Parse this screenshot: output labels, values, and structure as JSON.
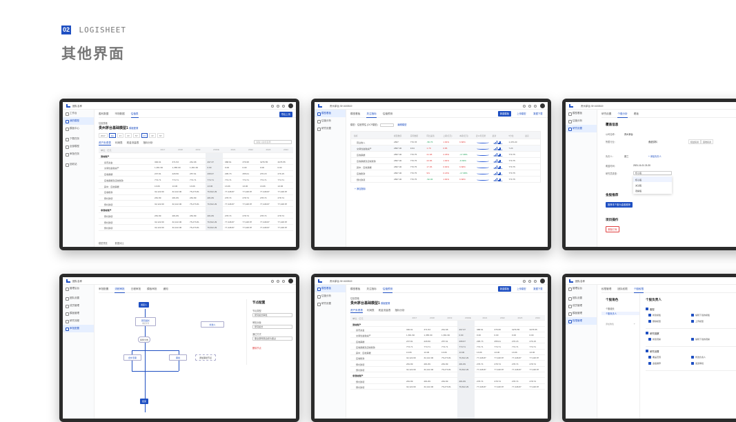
{
  "header": {
    "badge": "02",
    "brand": "LOGISHEET",
    "title": "其他界面"
  },
  "shot1": {
    "topbar": {
      "company": "团队名称"
    },
    "sidebar": [
      "工作台",
      "我的模型",
      "模板中心",
      "下载任务",
      "全部模型",
      "审批任务",
      "回收站"
    ],
    "tabs": [
      "盈利数据",
      "市场数据",
      "估值表"
    ],
    "action_button": "导出上传",
    "crumb": "估值表格",
    "title": "贵州茅台基础模型1",
    "title_link": "模板配置",
    "subtabs": [
      "资产负债表",
      "利润表",
      "现金流量表",
      "指标分析"
    ],
    "search_placeholder": "请输入指标名称",
    "col_headers": [
      "单位：亿元",
      "2017",
      "2018",
      "2019",
      "2020E",
      "2021",
      "2022",
      "2023",
      "2024"
    ],
    "rows": [
      {
        "label": "流动资产",
        "vals": []
      },
      {
        "label": "货币资金",
        "vals": [
          "300.01",
          "371.53",
          "261.68",
          "297.37",
          "388.61",
          "376.95",
          "3276.55",
          "3276.55"
        ]
      },
      {
        "label": "交易性金融资产",
        "vals": [
          "1,361.60",
          "1,365.00",
          "1,361.60",
          "0.00",
          "0.00",
          "0.00",
          "0.00",
          "0.00"
        ]
      },
      {
        "label": "应收票据",
        "vals": [
          "237.81",
          "226.56",
          "257.61",
          "295.67",
          "295.73",
          "255.01",
          "276.15",
          "276.15"
        ]
      },
      {
        "label": "应收票据及应收账款",
        "vals": [
          "774.71",
          "774.71",
          "774.71",
          "774.71",
          "774.71",
          "774.71",
          "774.71",
          "774.71"
        ]
      },
      {
        "label": "其中：应收票据",
        "vals": [
          "13.06",
          "13.06",
          "13.06",
          "13.06",
          "13.06",
          "13.06",
          "13.06",
          "13.06"
        ]
      },
      {
        "label": "应收账款",
        "vals": [
          "32,122.00",
          "32,122.00",
          "75,273.81",
          "76,812.29",
          "77,448.87",
          "77,448.87",
          "77,448.87",
          "77,448.87"
        ]
      },
      {
        "label": "预付款项",
        "vals": [
          "281.89",
          "281.89",
          "281.89",
          "281.89",
          "278.74",
          "278.74",
          "278.74",
          "278.74"
        ]
      },
      {
        "label": "预付款项",
        "vals": [
          "32,122.00",
          "32,122.00",
          "75,273.81",
          "76,812.29",
          "77,448.87",
          "77,448.87",
          "77,448.87",
          "77,448.87"
        ]
      },
      {
        "label": "非流动资产",
        "vals": []
      },
      {
        "label": "预付款项",
        "vals": [
          "281.89",
          "281.89",
          "281.89",
          "281.89",
          "278.74",
          "278.74",
          "278.74",
          "278.74"
        ]
      },
      {
        "label": "预付款项",
        "vals": [
          "32,122.00",
          "32,122.00",
          "75,273.81",
          "76,812.29",
          "77,448.87",
          "77,448.87",
          "77,448.87",
          "77,448.87"
        ]
      },
      {
        "label": "预付款项",
        "vals": [
          "32,122.00",
          "32,122.00",
          "75,273.81",
          "76,812.29",
          "77,448.87",
          "77,448.87",
          "77,448.87",
          "77,448.87"
        ]
      }
    ],
    "footer": [
      "模型预览",
      "数据对比"
    ]
  },
  "shot2": {
    "topbar": {
      "company": "贵州茅台 SH.600519"
    },
    "sidebar": [
      "模型看板",
      "估值分析",
      "研究设置"
    ],
    "tabs": [
      "模型看板",
      "关注指标",
      "估值预测"
    ],
    "buttons": [
      "新建模板",
      "上传模型",
      "数据下载"
    ],
    "filter_label": "模型：",
    "filter_value": "估值预估 (DCF模型)",
    "filter_link": "编辑模型",
    "col_headers": [
      "指标",
      "模型数值",
      "实际数据",
      "同比差值",
      "上期(亿元)",
      "本期(亿元)",
      "近12月走势",
      "最新",
      "5分位",
      "最高"
    ],
    "rows": [
      {
        "label": "营业收入",
        "vals": [
          "2807",
          "770.78",
          "-56.76",
          "1.84%",
          "6.68%",
          "1,470.20"
        ]
      },
      {
        "label": "交易性金融资产",
        "vals": [
          "2807.00",
          "9.64",
          "1.79",
          "0.85",
          "",
          "7.23"
        ]
      },
      {
        "label": "应收票据",
        "vals": [
          "2807.00",
          "770.75",
          "21.98",
          "2.45%",
          "-17.38%",
          "770.75"
        ]
      },
      {
        "label": "应收票据及应收账款",
        "vals": [
          "2807.00",
          "770.75",
          "23.86",
          "1.84%",
          "-8.30%",
          "770.75"
        ]
      },
      {
        "label": "其中：应收票据",
        "vals": [
          "2807.00",
          "770.75",
          "17.06",
          "0.84%",
          "6.68%",
          "770.75"
        ]
      },
      {
        "label": "应收账款",
        "vals": [
          "2807.00",
          "770.75",
          "9%",
          "0.18%",
          "-17.38%",
          "770.75"
        ]
      },
      {
        "label": "预付款项",
        "vals": [
          "2807.00",
          "770.75",
          "-52.06",
          "1.84%",
          "6.68%",
          "770.75"
        ]
      }
    ],
    "add_link": "+ 添加指标"
  },
  "shot3": {
    "topbar": {
      "company": "贵州茅台 SH.600519"
    },
    "sidebar": [
      "模型看板",
      "估值分析",
      "研究设置"
    ],
    "tabs": [
      "研究设置",
      "个股分析",
      "看板"
    ],
    "section1": "覆盖信息",
    "fields": [
      {
        "label": "公司名称：",
        "value": "贵州茅台"
      },
      {
        "label": "所属行业：",
        "value": "食品饮料"
      },
      {
        "label": "负责人：",
        "value": "张三"
      },
      {
        "label": "覆盖时间：",
        "value": "2021-11-01 21:20"
      },
      {
        "label": "研究员类型：",
        "value": "核心股"
      }
    ],
    "tags": [
      "权益投资",
      "固收投资"
    ],
    "add_manager": "+ 添加负责人",
    "dropdown_options": [
      "核心股",
      "关注股",
      "观察股"
    ],
    "section2": "金股推荐",
    "recommend_button": "推荐本个股为金股推荐",
    "section3": "项目操作",
    "delete_button": "删除已有"
  },
  "shot4": {
    "topbar": {
      "company": "团队名称"
    },
    "sidebar": [
      "管理后台",
      "团队设置",
      "成员管理",
      "模板管理",
      "研究流程",
      "审批配置"
    ],
    "tabs": [
      "审批配置",
      "流程审批",
      "日程审批",
      "模板审批",
      "通知"
    ],
    "nodes": {
      "start": "发起人",
      "n1": "研究组长",
      "n2": "审核条件",
      "n3": "条件分支",
      "n4": "合伙专审",
      "n5": "审批",
      "n6": "添加审批节点",
      "end": "结束",
      "cc": "抄送人"
    },
    "panel_title": "节点配置",
    "panel_fields": [
      {
        "label": "节点类型",
        "value": "研究组长审批"
      },
      {
        "label": "审批对象",
        "value": "研究组长"
      },
      {
        "label": "通过方式",
        "value": "需全部同意后视为通过"
      }
    ],
    "panel_delete": "删除节点"
  },
  "shot5": {
    "topbar": {
      "company": "贵州茅台 SH.600519"
    },
    "sidebar": [
      "模型看板",
      "估值分析",
      "研究设置"
    ],
    "tabs": [
      "模型看板",
      "关注指标",
      "估值预测"
    ],
    "buttons": [
      "新建模板",
      "上传模型",
      "数据下载"
    ],
    "crumb": "估值表格",
    "title": "贵州茅台基础模型1",
    "title_link": "模板配置",
    "subtabs": [
      "资产负债表",
      "利润表",
      "现金流量表",
      "指标分析"
    ],
    "col_headers": [
      "单位：亿元",
      "2017",
      "2018",
      "2019",
      "2020E",
      "2021",
      "2022",
      "2023",
      "2024"
    ],
    "rows": [
      {
        "label": "流动资产",
        "vals": []
      },
      {
        "label": "货币资金",
        "vals": [
          "300.01",
          "371.53",
          "261.68",
          "297.37",
          "388.61",
          "376.95",
          "3276.55",
          "3276.55"
        ]
      },
      {
        "label": "交易性金融资产",
        "vals": [
          "1,361.60",
          "1,365.00",
          "1,361.60",
          "0.00",
          "0.00",
          "0.00",
          "0.00",
          "0.00"
        ]
      },
      {
        "label": "应收票据",
        "vals": [
          "237.81",
          "226.56",
          "257.61",
          "295.67",
          "295.73",
          "255.01",
          "276.15",
          "276.15"
        ]
      },
      {
        "label": "应收票据及应收账款",
        "vals": [
          "774.71",
          "774.71",
          "774.71",
          "774.71",
          "774.71",
          "774.71",
          "774.71",
          "774.71"
        ]
      },
      {
        "label": "其中：应收票据",
        "vals": [
          "13.06",
          "13.06",
          "13.06",
          "13.06",
          "13.06",
          "13.06",
          "13.06",
          "13.06"
        ]
      },
      {
        "label": "应收账款",
        "vals": [
          "32,122.00",
          "32,122.00",
          "75,273.81",
          "76,812.29",
          "77,448.87",
          "77,448.87",
          "77,448.87",
          "77,448.87"
        ]
      },
      {
        "label": "预付款项",
        "vals": [
          "281.89",
          "281.89",
          "281.89",
          "281.89",
          "278.74",
          "278.74",
          "278.74",
          "278.74"
        ]
      },
      {
        "label": "预付款项",
        "vals": [
          "32,122.00",
          "32,122.00",
          "75,273.81",
          "76,812.29",
          "77,448.87",
          "77,448.87",
          "77,448.87",
          "77,448.87"
        ]
      },
      {
        "label": "非流动资产",
        "vals": []
      },
      {
        "label": "预付款项",
        "vals": [
          "281.89",
          "281.89",
          "281.89",
          "281.89",
          "278.74",
          "278.74",
          "278.74",
          "278.74"
        ]
      },
      {
        "label": "预付款项",
        "vals": [
          "32,122.00",
          "32,122.00",
          "75,273.81",
          "76,812.29",
          "77,448.87",
          "77,448.87",
          "77,448.87",
          "77,448.87"
        ]
      }
    ]
  },
  "shot6": {
    "topbar": {
      "company": "团队名称"
    },
    "sidebar": [
      "管理后台",
      "团队设置",
      "成员管理",
      "模板管理",
      "权限管理"
    ],
    "tabs": [
      "权限管理",
      "团队权限",
      "个股权限"
    ],
    "roles_title": "个股角色",
    "roles": [
      "个股组长",
      "个股负责人"
    ],
    "add_role": "添加角色",
    "perm_title": "个股负责人",
    "groups": [
      {
        "name": "模型",
        "items": [
          "新建模板",
          "编辑下载的模板",
          "删除模型",
          "上传模型"
        ]
      },
      {
        "name": "研究观察",
        "items": [
          "新建观察",
          "编辑下载的观察"
        ]
      },
      {
        "name": "研究设置",
        "items": [
          "覆盖范围",
          "修改负责人",
          "金股推荐",
          "发送审批"
        ]
      }
    ]
  }
}
